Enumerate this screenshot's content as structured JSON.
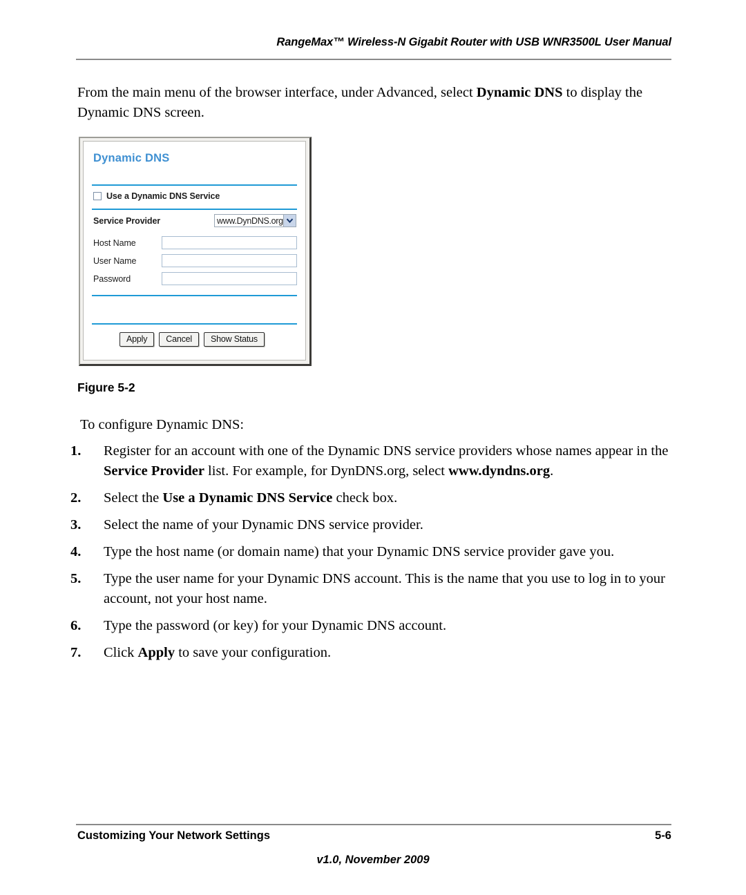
{
  "header": {
    "running_title": "RangeMax™ Wireless-N Gigabit Router with USB WNR3500L User Manual"
  },
  "intro": {
    "part1": "From the main menu of the browser interface, under Advanced, select ",
    "bold1": "Dynamic DNS",
    "part2": " to display the Dynamic DNS screen."
  },
  "figure": {
    "caption": "Figure 5-2",
    "screenshot": {
      "panel_title": "Dynamic DNS",
      "title_color": "#3f90d2",
      "rule_color": "#1f9ad6",
      "checkbox": {
        "label": "Use a Dynamic DNS Service",
        "checked": false
      },
      "fields": [
        {
          "label": "Service Provider",
          "type": "select",
          "value": "www.DynDNS.org"
        },
        {
          "label": "Host Name",
          "type": "text",
          "value": ""
        },
        {
          "label": "User Name",
          "type": "text",
          "value": ""
        },
        {
          "label": "Password",
          "type": "text",
          "value": ""
        }
      ],
      "buttons": [
        {
          "label": "Apply"
        },
        {
          "label": "Cancel"
        },
        {
          "label": "Show Status"
        }
      ]
    }
  },
  "lead_in": "To configure Dynamic DNS:",
  "steps": [
    {
      "num": "1.",
      "segments": [
        {
          "text": "Register for an account with one of the Dynamic DNS service providers whose names appear in the ",
          "bold": false
        },
        {
          "text": "Service Provider",
          "bold": true
        },
        {
          "text": " list. For example, for DynDNS.org, select ",
          "bold": false
        },
        {
          "text": "www.dyndns.org",
          "bold": true
        },
        {
          "text": ".",
          "bold": false
        }
      ]
    },
    {
      "num": "2.",
      "segments": [
        {
          "text": "Select the ",
          "bold": false
        },
        {
          "text": "Use a Dynamic DNS Service",
          "bold": true
        },
        {
          "text": " check box.",
          "bold": false
        }
      ]
    },
    {
      "num": "3.",
      "segments": [
        {
          "text": "Select the name of your Dynamic DNS service provider.",
          "bold": false
        }
      ]
    },
    {
      "num": "4.",
      "segments": [
        {
          "text": "Type the host name (or domain name) that your Dynamic DNS service provider gave you.",
          "bold": false
        }
      ]
    },
    {
      "num": "5.",
      "segments": [
        {
          "text": "Type the user name for your Dynamic DNS account. This is the name that you use to log in to your account, not your host name.",
          "bold": false
        }
      ]
    },
    {
      "num": "6.",
      "segments": [
        {
          "text": "Type the password (or key) for your Dynamic DNS account.",
          "bold": false
        }
      ]
    },
    {
      "num": "7.",
      "segments": [
        {
          "text": "Click ",
          "bold": false
        },
        {
          "text": "Apply",
          "bold": true
        },
        {
          "text": " to save your configuration.",
          "bold": false
        }
      ]
    }
  ],
  "footer": {
    "left": "Customizing Your Network Settings",
    "page_number": "5-6",
    "version": "v1.0, November 2009"
  }
}
